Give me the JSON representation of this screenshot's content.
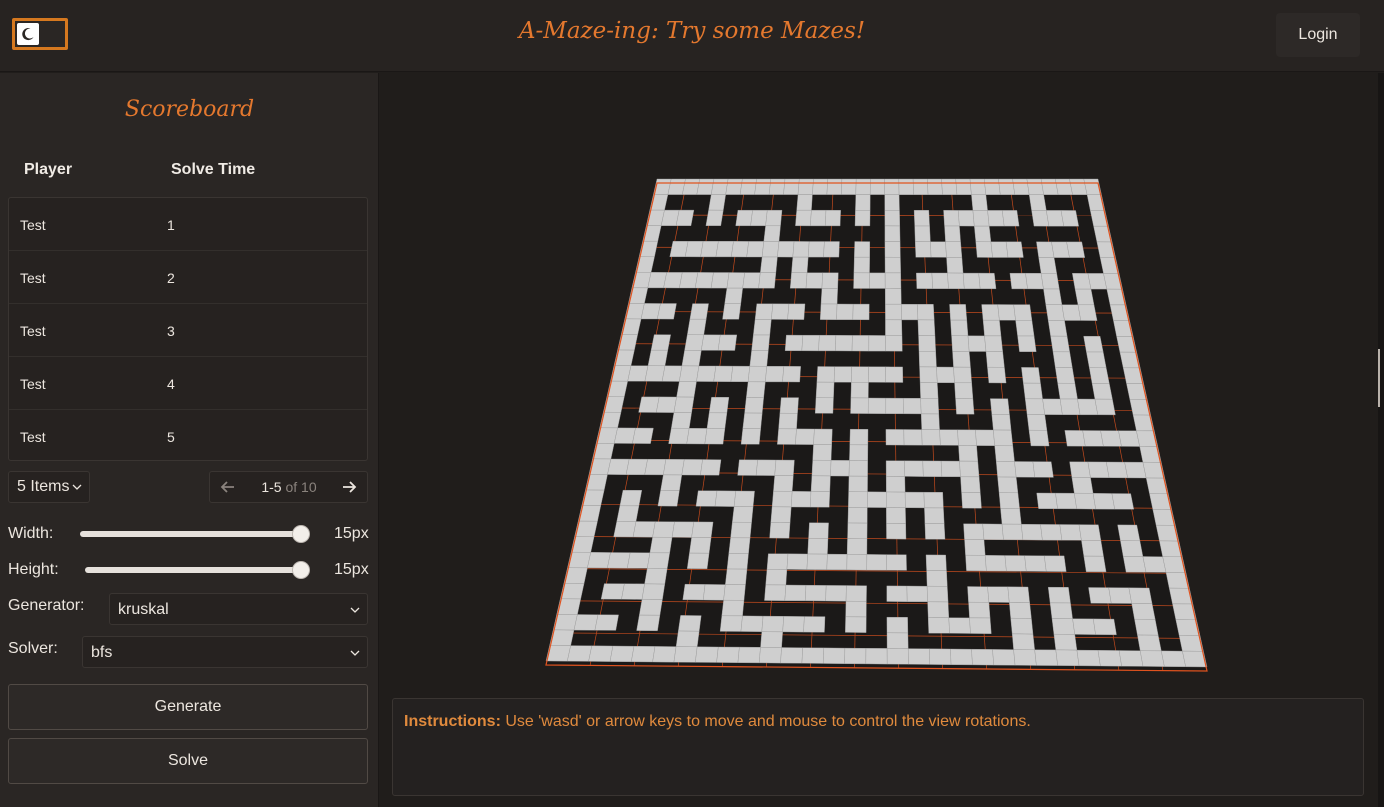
{
  "header": {
    "title": "A-Maze-ing: Try some Mazes!",
    "login_label": "Login",
    "theme_toggle_icon": "moon-icon"
  },
  "scoreboard": {
    "title": "Scoreboard",
    "columns": [
      "Player",
      "Solve Time"
    ],
    "rows": [
      {
        "player": "Test",
        "time": "1"
      },
      {
        "player": "Test",
        "time": "2"
      },
      {
        "player": "Test",
        "time": "3"
      },
      {
        "player": "Test",
        "time": "4"
      },
      {
        "player": "Test",
        "time": "5"
      }
    ],
    "page_size": "5 Items",
    "range": "1-5",
    "of_total": "of 10"
  },
  "controls": {
    "width_label": "Width:",
    "width_value": "15px",
    "height_label": "Height:",
    "height_value": "15px",
    "generator_label": "Generator:",
    "generator_value": "kruskal",
    "solver_label": "Solver:",
    "solver_value": "bfs",
    "generate_label": "Generate",
    "solve_label": "Solve"
  },
  "instructions": {
    "prefix": "Instructions:",
    "text": "Use 'wasd' or arrow keys to move and mouse to control the view rotations."
  },
  "colors": {
    "accent": "#e4782e",
    "grid_line": "#e0531f",
    "wall": "#cfcfcf",
    "background": "#201d1b"
  },
  "maze": {
    "rows": 31,
    "cols": 31,
    "generator": "kruskal"
  }
}
